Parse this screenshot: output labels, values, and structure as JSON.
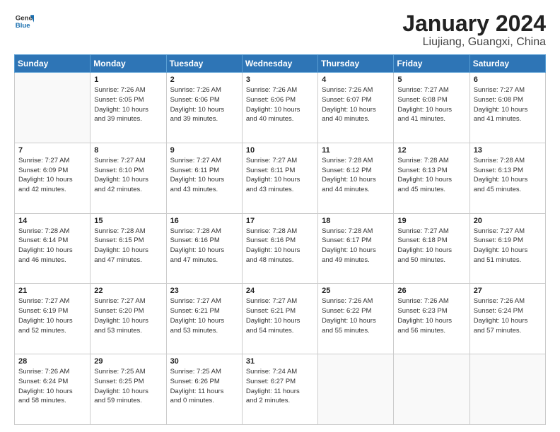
{
  "header": {
    "logo": {
      "line1": "General",
      "line2": "Blue"
    },
    "title": "January 2024",
    "subtitle": "Liujiang, Guangxi, China"
  },
  "weekdays": [
    "Sunday",
    "Monday",
    "Tuesday",
    "Wednesday",
    "Thursday",
    "Friday",
    "Saturday"
  ],
  "weeks": [
    [
      {
        "day": "",
        "info": ""
      },
      {
        "day": "1",
        "info": "Sunrise: 7:26 AM\nSunset: 6:05 PM\nDaylight: 10 hours\nand 39 minutes."
      },
      {
        "day": "2",
        "info": "Sunrise: 7:26 AM\nSunset: 6:06 PM\nDaylight: 10 hours\nand 39 minutes."
      },
      {
        "day": "3",
        "info": "Sunrise: 7:26 AM\nSunset: 6:06 PM\nDaylight: 10 hours\nand 40 minutes."
      },
      {
        "day": "4",
        "info": "Sunrise: 7:26 AM\nSunset: 6:07 PM\nDaylight: 10 hours\nand 40 minutes."
      },
      {
        "day": "5",
        "info": "Sunrise: 7:27 AM\nSunset: 6:08 PM\nDaylight: 10 hours\nand 41 minutes."
      },
      {
        "day": "6",
        "info": "Sunrise: 7:27 AM\nSunset: 6:08 PM\nDaylight: 10 hours\nand 41 minutes."
      }
    ],
    [
      {
        "day": "7",
        "info": "Sunrise: 7:27 AM\nSunset: 6:09 PM\nDaylight: 10 hours\nand 42 minutes."
      },
      {
        "day": "8",
        "info": "Sunrise: 7:27 AM\nSunset: 6:10 PM\nDaylight: 10 hours\nand 42 minutes."
      },
      {
        "day": "9",
        "info": "Sunrise: 7:27 AM\nSunset: 6:11 PM\nDaylight: 10 hours\nand 43 minutes."
      },
      {
        "day": "10",
        "info": "Sunrise: 7:27 AM\nSunset: 6:11 PM\nDaylight: 10 hours\nand 43 minutes."
      },
      {
        "day": "11",
        "info": "Sunrise: 7:28 AM\nSunset: 6:12 PM\nDaylight: 10 hours\nand 44 minutes."
      },
      {
        "day": "12",
        "info": "Sunrise: 7:28 AM\nSunset: 6:13 PM\nDaylight: 10 hours\nand 45 minutes."
      },
      {
        "day": "13",
        "info": "Sunrise: 7:28 AM\nSunset: 6:13 PM\nDaylight: 10 hours\nand 45 minutes."
      }
    ],
    [
      {
        "day": "14",
        "info": "Sunrise: 7:28 AM\nSunset: 6:14 PM\nDaylight: 10 hours\nand 46 minutes."
      },
      {
        "day": "15",
        "info": "Sunrise: 7:28 AM\nSunset: 6:15 PM\nDaylight: 10 hours\nand 47 minutes."
      },
      {
        "day": "16",
        "info": "Sunrise: 7:28 AM\nSunset: 6:16 PM\nDaylight: 10 hours\nand 47 minutes."
      },
      {
        "day": "17",
        "info": "Sunrise: 7:28 AM\nSunset: 6:16 PM\nDaylight: 10 hours\nand 48 minutes."
      },
      {
        "day": "18",
        "info": "Sunrise: 7:28 AM\nSunset: 6:17 PM\nDaylight: 10 hours\nand 49 minutes."
      },
      {
        "day": "19",
        "info": "Sunrise: 7:27 AM\nSunset: 6:18 PM\nDaylight: 10 hours\nand 50 minutes."
      },
      {
        "day": "20",
        "info": "Sunrise: 7:27 AM\nSunset: 6:19 PM\nDaylight: 10 hours\nand 51 minutes."
      }
    ],
    [
      {
        "day": "21",
        "info": "Sunrise: 7:27 AM\nSunset: 6:19 PM\nDaylight: 10 hours\nand 52 minutes."
      },
      {
        "day": "22",
        "info": "Sunrise: 7:27 AM\nSunset: 6:20 PM\nDaylight: 10 hours\nand 53 minutes."
      },
      {
        "day": "23",
        "info": "Sunrise: 7:27 AM\nSunset: 6:21 PM\nDaylight: 10 hours\nand 53 minutes."
      },
      {
        "day": "24",
        "info": "Sunrise: 7:27 AM\nSunset: 6:21 PM\nDaylight: 10 hours\nand 54 minutes."
      },
      {
        "day": "25",
        "info": "Sunrise: 7:26 AM\nSunset: 6:22 PM\nDaylight: 10 hours\nand 55 minutes."
      },
      {
        "day": "26",
        "info": "Sunrise: 7:26 AM\nSunset: 6:23 PM\nDaylight: 10 hours\nand 56 minutes."
      },
      {
        "day": "27",
        "info": "Sunrise: 7:26 AM\nSunset: 6:24 PM\nDaylight: 10 hours\nand 57 minutes."
      }
    ],
    [
      {
        "day": "28",
        "info": "Sunrise: 7:26 AM\nSunset: 6:24 PM\nDaylight: 10 hours\nand 58 minutes."
      },
      {
        "day": "29",
        "info": "Sunrise: 7:25 AM\nSunset: 6:25 PM\nDaylight: 10 hours\nand 59 minutes."
      },
      {
        "day": "30",
        "info": "Sunrise: 7:25 AM\nSunset: 6:26 PM\nDaylight: 11 hours\nand 0 minutes."
      },
      {
        "day": "31",
        "info": "Sunrise: 7:24 AM\nSunset: 6:27 PM\nDaylight: 11 hours\nand 2 minutes."
      },
      {
        "day": "",
        "info": ""
      },
      {
        "day": "",
        "info": ""
      },
      {
        "day": "",
        "info": ""
      }
    ]
  ]
}
